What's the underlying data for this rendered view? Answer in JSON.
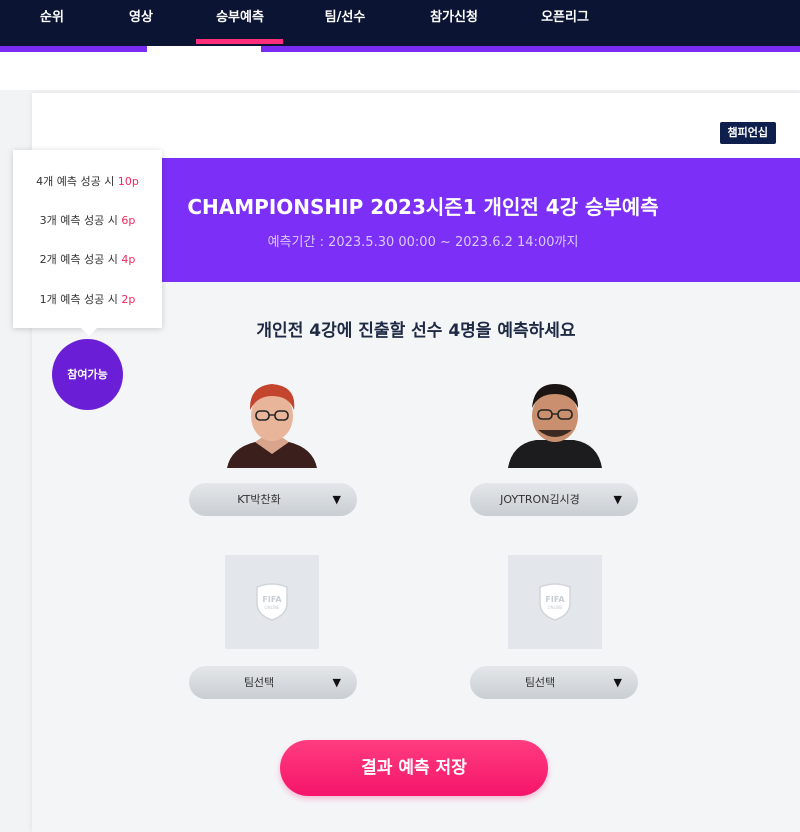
{
  "nav": {
    "items": [
      {
        "label": "순위"
      },
      {
        "label": "영상"
      },
      {
        "label": "승부예측"
      },
      {
        "label": "팀/선수"
      },
      {
        "label": "참가신청"
      },
      {
        "label": "오픈리그"
      }
    ],
    "active_index": 2
  },
  "card": {
    "badge": "챔피언십",
    "banner_title": "CHAMPIONSHIP 2023시즌1 개인전 4강 승부예측",
    "banner_subtitle": "예측기간 : 2023.5.30 00:00 ~ 2023.6.2 14:00까지",
    "question": "개인전 4강에 진출할 선수 4명을 예측하세요",
    "selects": [
      {
        "value": "KT박찬화"
      },
      {
        "value": "JOYTRON김시경"
      },
      {
        "value": "팀선택"
      },
      {
        "value": "팀선택"
      }
    ],
    "arrow": "▼",
    "placeholder_logo_text": "FIFA ONLINE",
    "save_button": "결과 예측 저장"
  },
  "reward_popup": {
    "rows": [
      {
        "text": "4개 예측 성공 시 ",
        "points": "10p"
      },
      {
        "text": "3개 예측 성공 시 ",
        "points": "6p"
      },
      {
        "text": "2개 예측 성공 시 ",
        "points": "4p"
      },
      {
        "text": "1개 예측 성공 시 ",
        "points": "2p"
      }
    ]
  },
  "status_circle": "참여가능",
  "colors": {
    "nav_bg": "#0b1433",
    "active_underline": "#ff2f7b",
    "banner": "#7b2ff7",
    "accent_points": "#f2275c",
    "save_button": "#f5146a",
    "status_circle": "#6a1fd6",
    "badge_bg": "#0e1f4d"
  }
}
